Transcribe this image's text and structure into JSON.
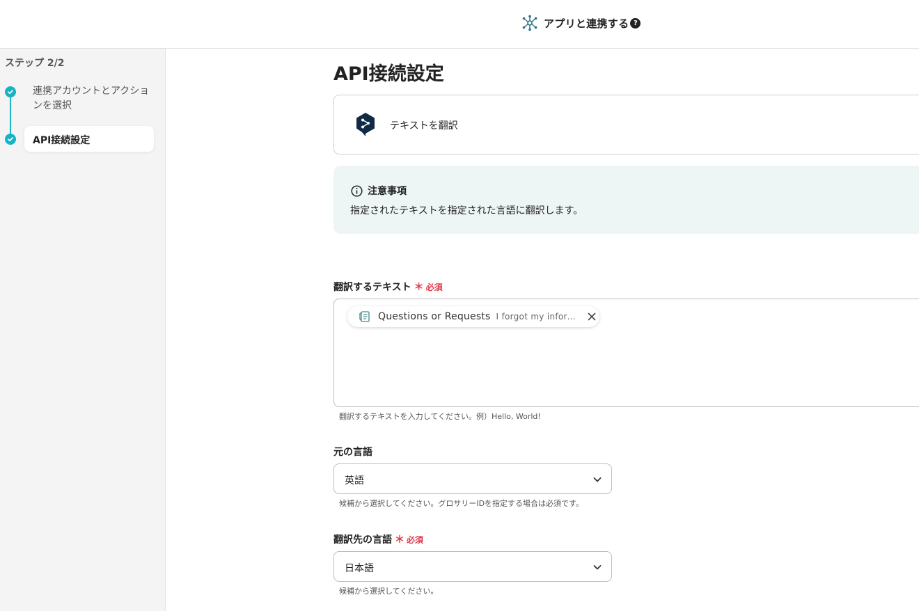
{
  "header": {
    "title": "アプリと連携する",
    "help_symbol": "?",
    "app_icon": "network-hub-icon"
  },
  "sidebar": {
    "step_count": "ステップ 2/2",
    "steps": [
      {
        "label": "連携アカウントとアクションを選択",
        "status": "done"
      },
      {
        "label": "API接続設定",
        "status": "current"
      }
    ],
    "accent_color": "#16b3c6"
  },
  "main": {
    "page_title": "API接続設定",
    "action": {
      "label": "テキストを翻訳",
      "icon": "deepl-logo-icon"
    },
    "notice": {
      "title": "注意事項",
      "body": "指定されたテキストを指定された言語に翻訳します。"
    },
    "fields": {
      "text": {
        "label": "翻訳するテキスト",
        "required_mark": "＊",
        "required_text": "必須",
        "chip": {
          "name": "Questions or Requests",
          "value": "I forgot my information and would like to reset it."
        },
        "hint": "翻訳するテキストを入力してください。例）Hello, World!"
      },
      "source_lang": {
        "label": "元の言語",
        "value": "英語",
        "hint": "候補から選択してください。グロサリーIDを指定する場合は必須です。"
      },
      "target_lang": {
        "label": "翻訳先の言語",
        "required_mark": "＊",
        "required_text": "必須",
        "value": "日本語",
        "hint": "候補から選択してください。"
      }
    },
    "required_color": "#e23b4c"
  }
}
